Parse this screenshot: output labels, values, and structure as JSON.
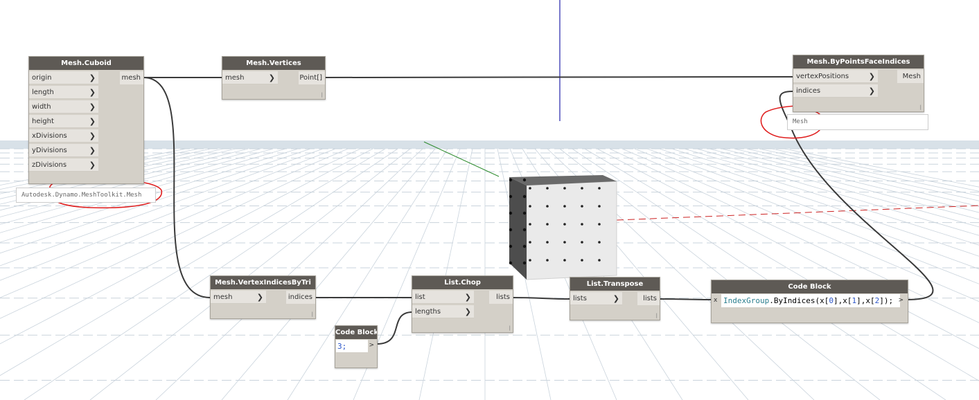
{
  "nodes": {
    "cuboid": {
      "title": "Mesh.Cuboid",
      "inputs": [
        "origin",
        "length",
        "width",
        "height",
        "xDivisions",
        "yDivisions",
        "zDivisions"
      ],
      "output": "mesh",
      "preview": "Autodesk.Dynamo.MeshToolkit.Mesh"
    },
    "vertices": {
      "title": "Mesh.Vertices",
      "input": "mesh",
      "output": "Point[]"
    },
    "by_points": {
      "title": "Mesh.ByPointsFaceIndices",
      "inputs": [
        "vertexPositions",
        "indices"
      ],
      "output": "Mesh",
      "preview": "Mesh"
    },
    "vertex_indices": {
      "title": "Mesh.VertexIndicesByTri",
      "input": "mesh",
      "output": "indices"
    },
    "chop": {
      "title": "List.Chop",
      "inputs": [
        "list",
        "lengths"
      ],
      "output": "lists"
    },
    "transpose": {
      "title": "List.Transpose",
      "input": "lists",
      "output": "lists"
    },
    "code_block_3": {
      "title": "Code Block",
      "code": "3;",
      "output_arrow": ">"
    },
    "code_block_index": {
      "title": "Code Block",
      "input": "x",
      "code_kw": "IndexGroup",
      "code_parts": [
        ".ByIndices(x[",
        "0",
        "],x[",
        "1",
        "],x[",
        "2",
        "]);"
      ],
      "output_arrow": ">"
    }
  },
  "colors": {
    "node_header": "#5e5a55",
    "node_body": "#d4d0c8",
    "port_bg": "#e6e3de",
    "wire": "#3a3a3a",
    "annotation": "#e02020",
    "grid": "#c9d3dc",
    "axis_blue": "#2222aa",
    "axis_green": "#2a8a2a",
    "axis_red": "#cc2222",
    "cube_face": "#e9e9e9",
    "cube_dark": "#4a4a4a"
  },
  "icons": [
    "port-arrow-icon",
    "output-arrow-icon"
  ]
}
